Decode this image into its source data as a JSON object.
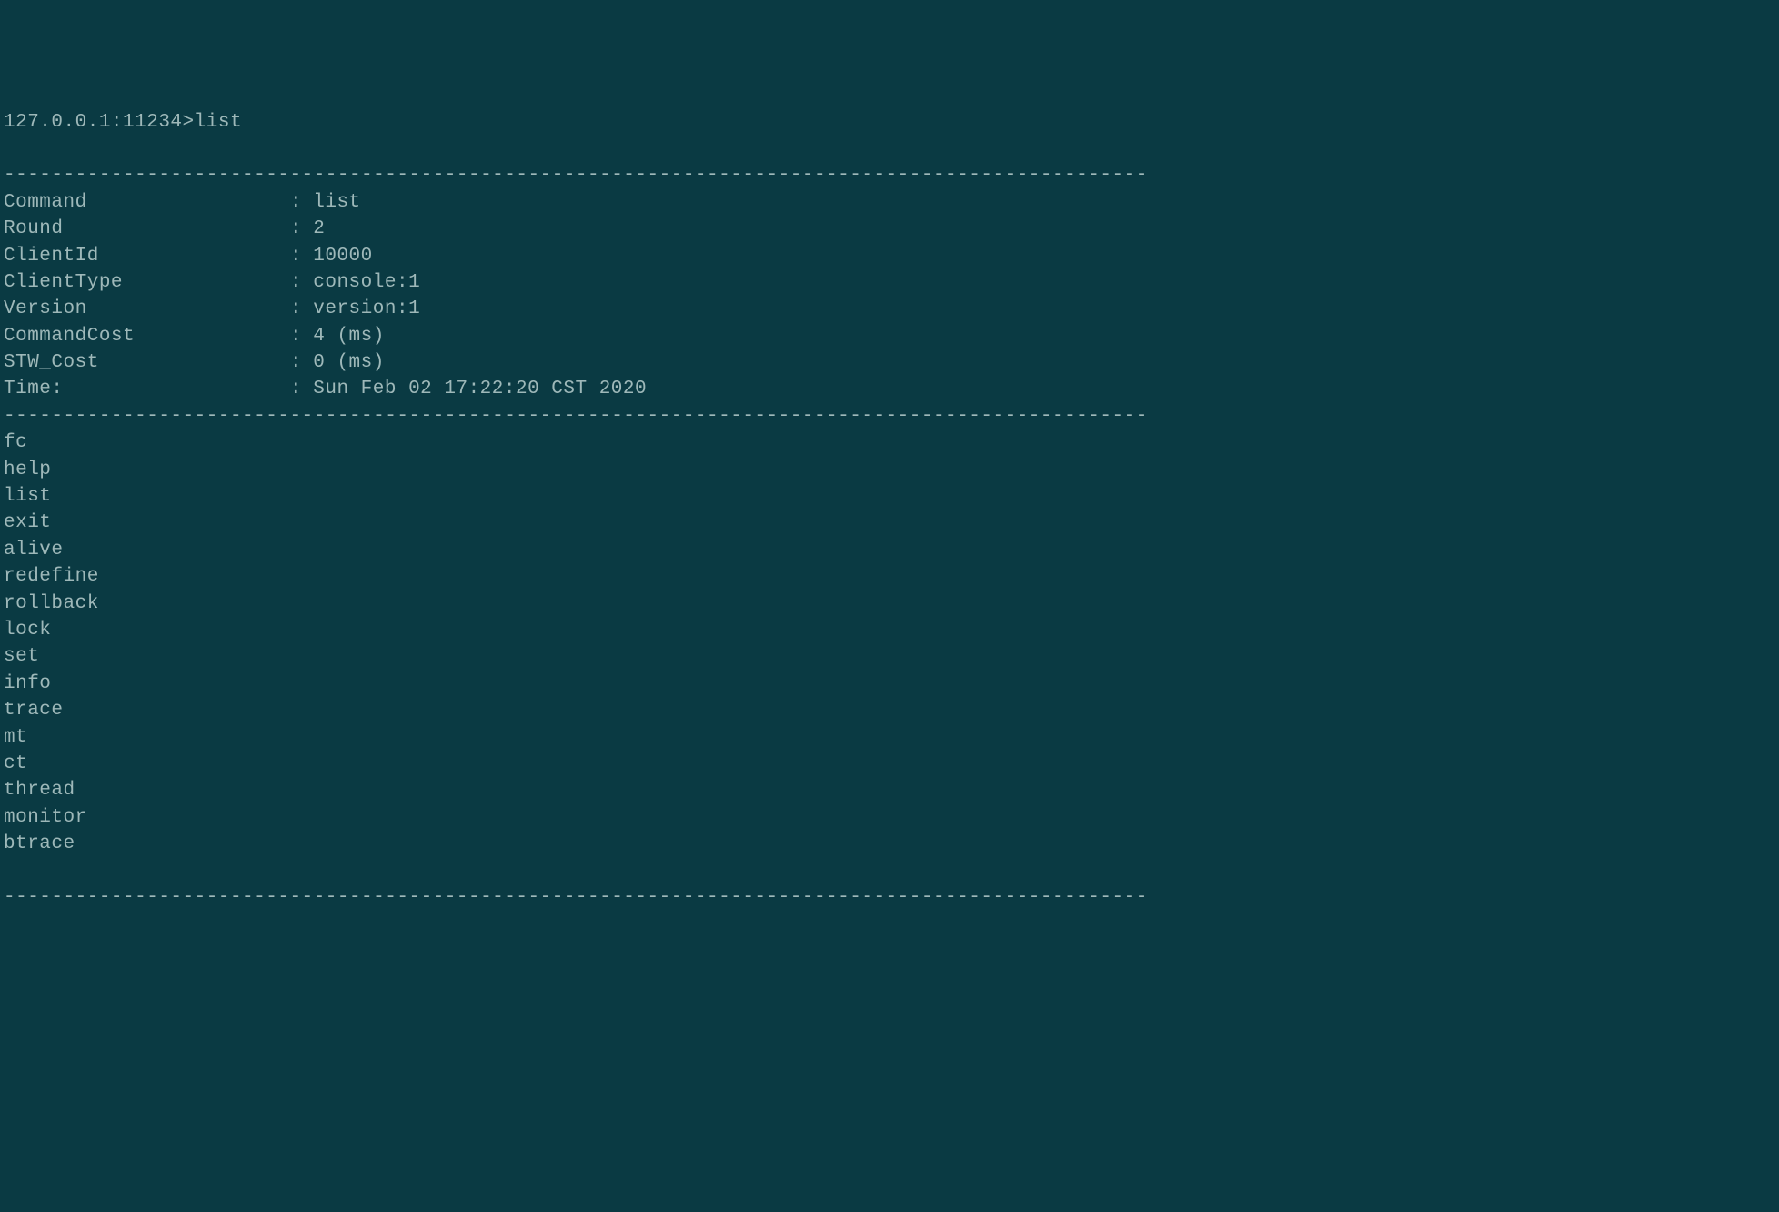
{
  "prompt": {
    "host": "127.0.0.1:11234",
    "symbol": ">",
    "command": "list"
  },
  "divider": "------------------------------------------------------------------------------------------------",
  "info": [
    {
      "key": "Command",
      "value": "list"
    },
    {
      "key": "Round",
      "value": "2"
    },
    {
      "key": "ClientId",
      "value": "10000"
    },
    {
      "key": "ClientType",
      "value": "console:1"
    },
    {
      "key": "Version",
      "value": "version:1"
    },
    {
      "key": "CommandCost",
      "value": "4 (ms)"
    },
    {
      "key": "STW_Cost",
      "value": "0 (ms)"
    },
    {
      "key": "Time:",
      "value": "Sun Feb 02 17:22:20 CST 2020"
    }
  ],
  "commands": [
    "fc",
    "help",
    "list",
    "exit",
    "alive",
    "redefine",
    "rollback",
    "lock",
    "set",
    "info",
    "trace",
    "mt",
    "ct",
    "thread",
    "monitor",
    "btrace"
  ]
}
